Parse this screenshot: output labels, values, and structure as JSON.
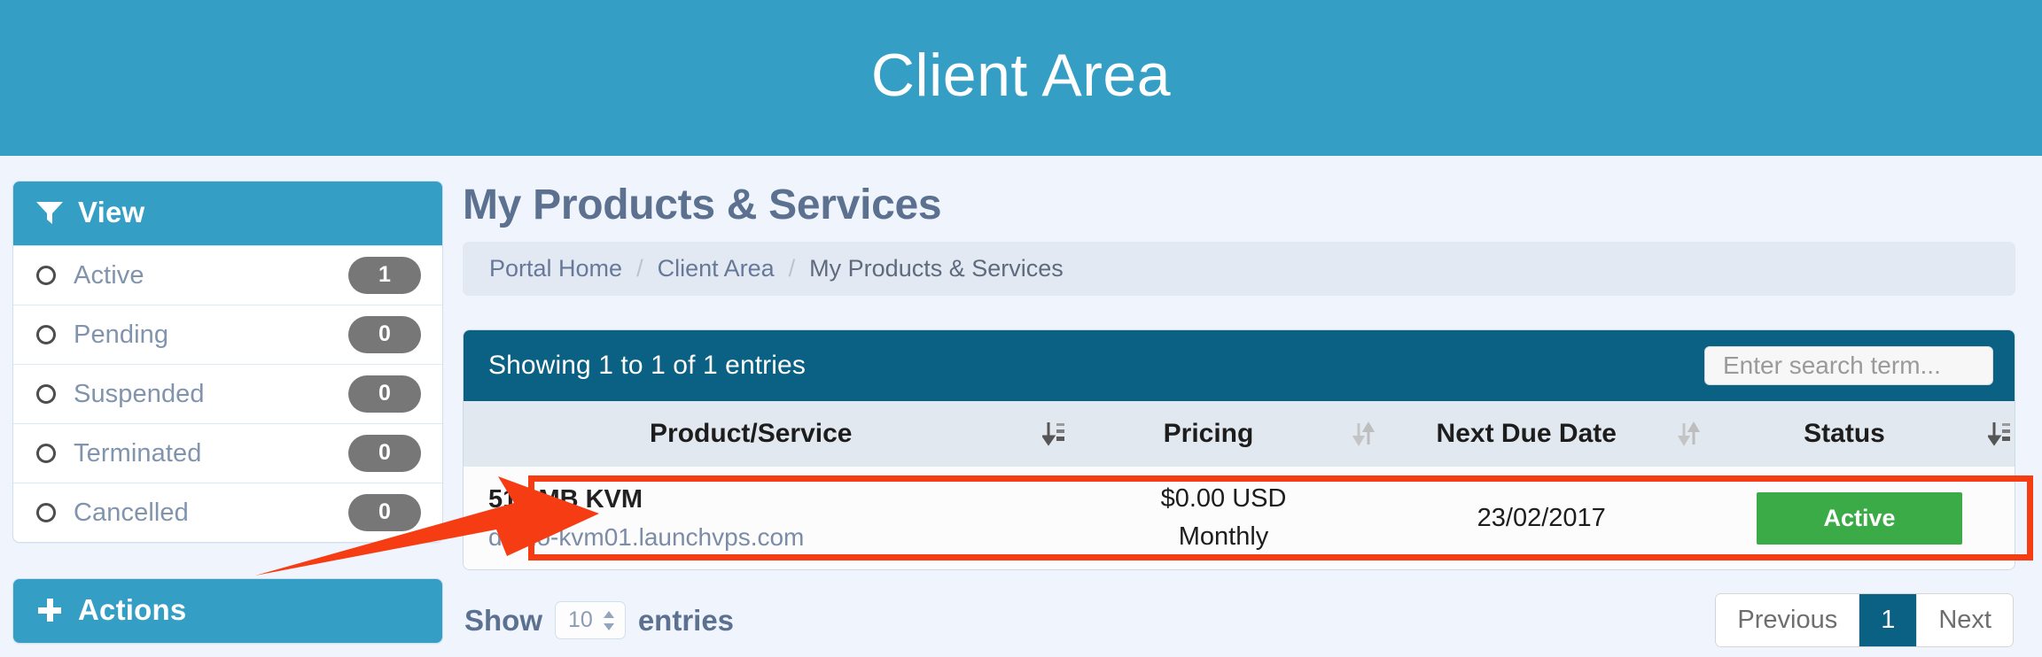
{
  "banner": {
    "title": "Client Area"
  },
  "sidebar": {
    "view_panel": {
      "title": "View",
      "icon": "filter-icon",
      "items": [
        {
          "label": "Active",
          "count": "1"
        },
        {
          "label": "Pending",
          "count": "0"
        },
        {
          "label": "Suspended",
          "count": "0"
        },
        {
          "label": "Terminated",
          "count": "0"
        },
        {
          "label": "Cancelled",
          "count": "0"
        }
      ]
    },
    "actions_panel": {
      "title": "Actions",
      "icon": "plus-icon"
    }
  },
  "main": {
    "page_title": "My Products & Services",
    "breadcrumb": {
      "items": [
        "Portal Home",
        "Client Area",
        "My Products & Services"
      ],
      "separator": "/"
    },
    "table_card": {
      "showing_text": "Showing 1 to 1 of 1 entries",
      "search": {
        "value": "",
        "placeholder": "Enter search term..."
      },
      "columns": [
        {
          "label": "Product/Service",
          "sort_icon": "sort-desc-icon",
          "sorted": true
        },
        {
          "label": "Pricing",
          "sort_icon": "sort-both-icon",
          "sorted": false
        },
        {
          "label": "Next Due Date",
          "sort_icon": "sort-both-icon",
          "sorted": false
        },
        {
          "label": "Status",
          "sort_icon": "sort-desc-icon",
          "sorted": true
        }
      ],
      "rows": [
        {
          "product": "512 MB KVM",
          "domain": "demo-kvm01.launchvps.com",
          "price_amount": "$0.00 USD",
          "price_cycle": "Monthly",
          "next_due_date": "23/02/2017",
          "status": "Active"
        }
      ]
    },
    "footer": {
      "show_label": "Show",
      "entries_value": "10",
      "entries_label": "entries",
      "pagination": {
        "previous": "Previous",
        "pages": [
          "1"
        ],
        "next": "Next",
        "active_page": "1"
      }
    }
  },
  "colors": {
    "banner_blue": "#349ec4",
    "panel_header_blue": "#349ec4",
    "card_header_teal": "#0a6183",
    "status_green": "#3aab46",
    "badge_gray": "#777777",
    "annotation_red": "#f63c12",
    "page_bg": "#f0f4fd"
  }
}
